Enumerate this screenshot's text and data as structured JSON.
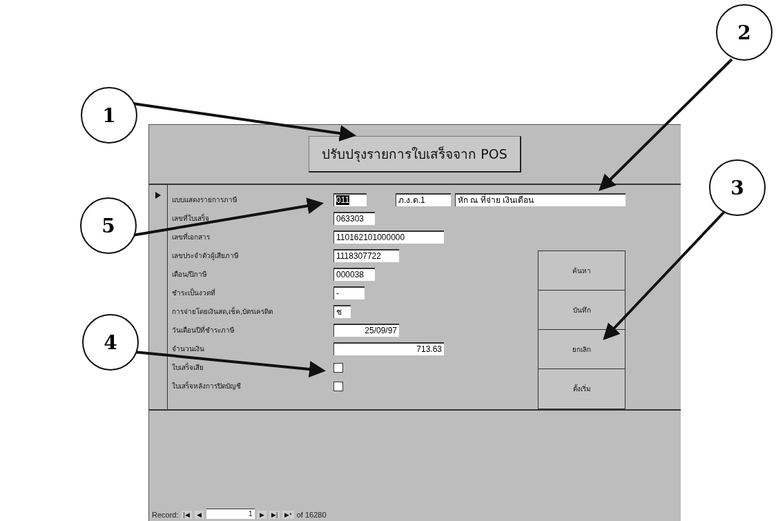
{
  "form": {
    "title": "ปรับปรุงรายการใบเสร็จจาก POS",
    "first_row": {
      "label": "แบบแสดงรายการภาษี",
      "code": {
        "value": "011",
        "highlighted": true
      },
      "form_type": "ภ.ง.ด.1",
      "description": "หัก ณ ที่จ่าย เงินเดือน"
    },
    "fields": [
      {
        "kind": "text",
        "label": "เลขที่ใบเสร็จ",
        "value": "063303"
      },
      {
        "kind": "text",
        "label": "เลขที่เอกสาร",
        "value": "110162101000000"
      },
      {
        "kind": "text",
        "label": "เลขประจำตัวผู้เสียภาษี",
        "value": "1118307722"
      },
      {
        "kind": "text",
        "label": "เดือน/ปีภาษี",
        "value": "000038"
      },
      {
        "kind": "text",
        "label": "ชำระเป็นงวดที่",
        "value": "-"
      },
      {
        "kind": "text",
        "label": "การจ่ายโดยเงินสด,เช็ค,บัตรเครดิต",
        "value": "ช"
      },
      {
        "kind": "number",
        "label": "วันเดือนปีที่ชำระภาษี",
        "value": "25/09/97"
      },
      {
        "kind": "number",
        "label": "จำนวนเงิน",
        "value": "713.63"
      },
      {
        "kind": "checkbox",
        "label": "ใบเสร็จเสีย",
        "checked": false
      },
      {
        "kind": "checkbox",
        "label": "ใบเสร็จหลังการปิดบัญชี",
        "checked": false
      }
    ],
    "buttons": [
      "ค้นหา",
      "บันทึก",
      "ยกเลิก",
      "ตั้งเริ่ม"
    ],
    "record_bar": {
      "label": "Record:",
      "first": "|◀",
      "prev": "◀",
      "current": "1",
      "next": "▶",
      "last": "▶|",
      "new": "▶*",
      "total": "of 16280"
    }
  },
  "callouts": [
    "2",
    "1",
    "3",
    "5",
    "4"
  ]
}
